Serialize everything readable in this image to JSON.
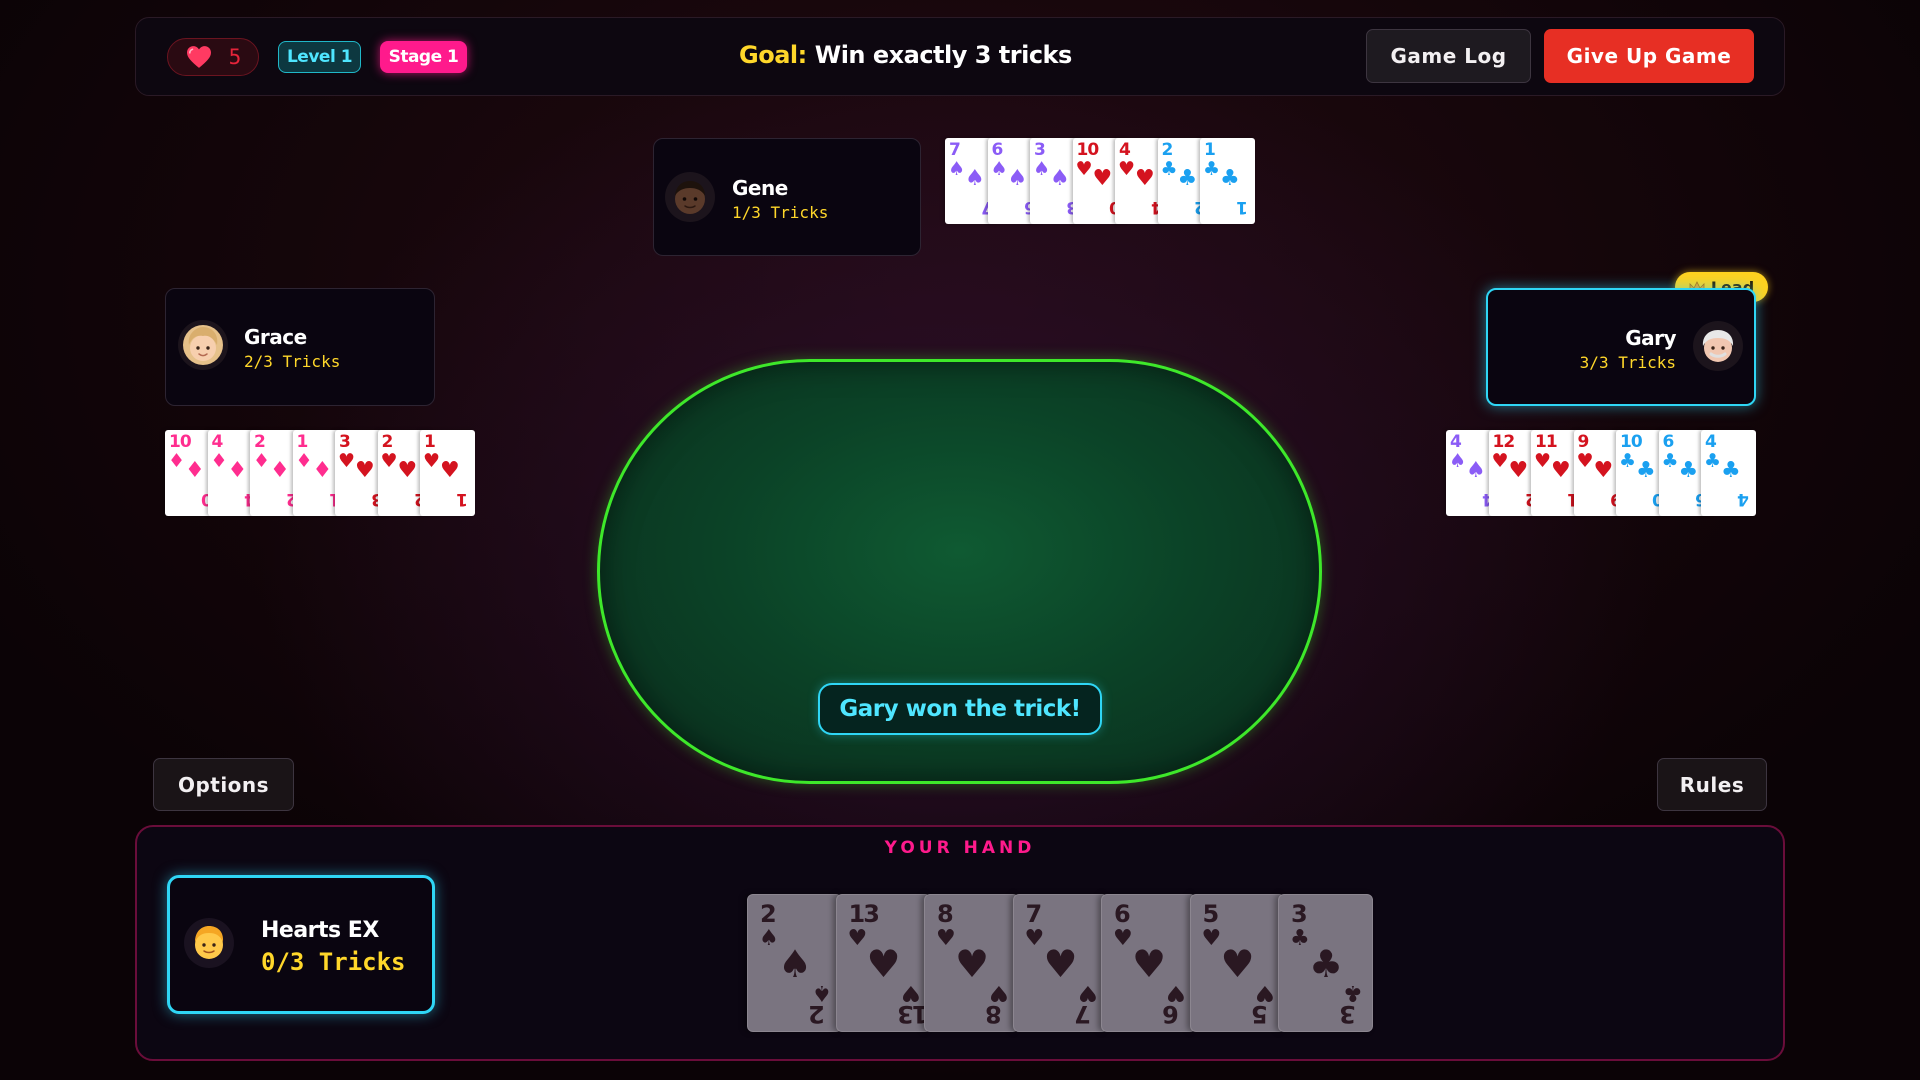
{
  "colors": {
    "accent_cyan": "#2fd6f5",
    "accent_pink": "#ff1a8c",
    "gold": "#ffd72a",
    "danger_red": "#e72f24",
    "table_border": "#3ee82a",
    "heart_red": "#e5243a",
    "diamond_pink": "#ff2d8f",
    "heart_card_red": "#d4131f",
    "spade_purple": "#8b5cf6",
    "club_blue": "#1aa0f0"
  },
  "topbar": {
    "lives_icon": "heart-icon",
    "lives": "5",
    "level": "Level 1",
    "stage": "Stage 1",
    "goal_label": "Goal:",
    "goal_text": "Win exactly 3 tricks",
    "game_log_label": "Game Log",
    "give_up_label": "Give Up Game"
  },
  "players": {
    "gene": {
      "name": "Gene",
      "tricks": "1/3 Tricks",
      "cards": [
        {
          "rank": "7",
          "suit": "♠"
        },
        {
          "rank": "6",
          "suit": "♠"
        },
        {
          "rank": "3",
          "suit": "♠"
        },
        {
          "rank": "10",
          "suit": "♥"
        },
        {
          "rank": "4",
          "suit": "♥"
        },
        {
          "rank": "2",
          "suit": "♣"
        },
        {
          "rank": "1",
          "suit": "♣"
        }
      ]
    },
    "grace": {
      "name": "Grace",
      "tricks": "2/3 Tricks",
      "cards": [
        {
          "rank": "10",
          "suit": "♦"
        },
        {
          "rank": "4",
          "suit": "♦"
        },
        {
          "rank": "2",
          "suit": "♦"
        },
        {
          "rank": "1",
          "suit": "♦"
        },
        {
          "rank": "3",
          "suit": "♥"
        },
        {
          "rank": "2",
          "suit": "♥"
        },
        {
          "rank": "1",
          "suit": "♥"
        }
      ]
    },
    "gary": {
      "name": "Gary",
      "tricks": "3/3 Tricks",
      "lead_label": "Lead",
      "cards": [
        {
          "rank": "4",
          "suit": "♠"
        },
        {
          "rank": "12",
          "suit": "♥"
        },
        {
          "rank": "11",
          "suit": "♥"
        },
        {
          "rank": "9",
          "suit": "♥"
        },
        {
          "rank": "10",
          "suit": "♣"
        },
        {
          "rank": "6",
          "suit": "♣"
        },
        {
          "rank": "4",
          "suit": "♣"
        }
      ]
    }
  },
  "table": {
    "message": "Gary won the trick!"
  },
  "options_label": "Options",
  "rules_label": "Rules",
  "hand": {
    "title": "YOUR HAND",
    "player_name": "Hearts EX",
    "tricks": "0/3 Tricks",
    "cards": [
      {
        "rank": "2",
        "suit": "♠"
      },
      {
        "rank": "13",
        "suit": "♥"
      },
      {
        "rank": "8",
        "suit": "♥"
      },
      {
        "rank": "7",
        "suit": "♥"
      },
      {
        "rank": "6",
        "suit": "♥"
      },
      {
        "rank": "5",
        "suit": "♥"
      },
      {
        "rank": "3",
        "suit": "♣"
      }
    ]
  }
}
